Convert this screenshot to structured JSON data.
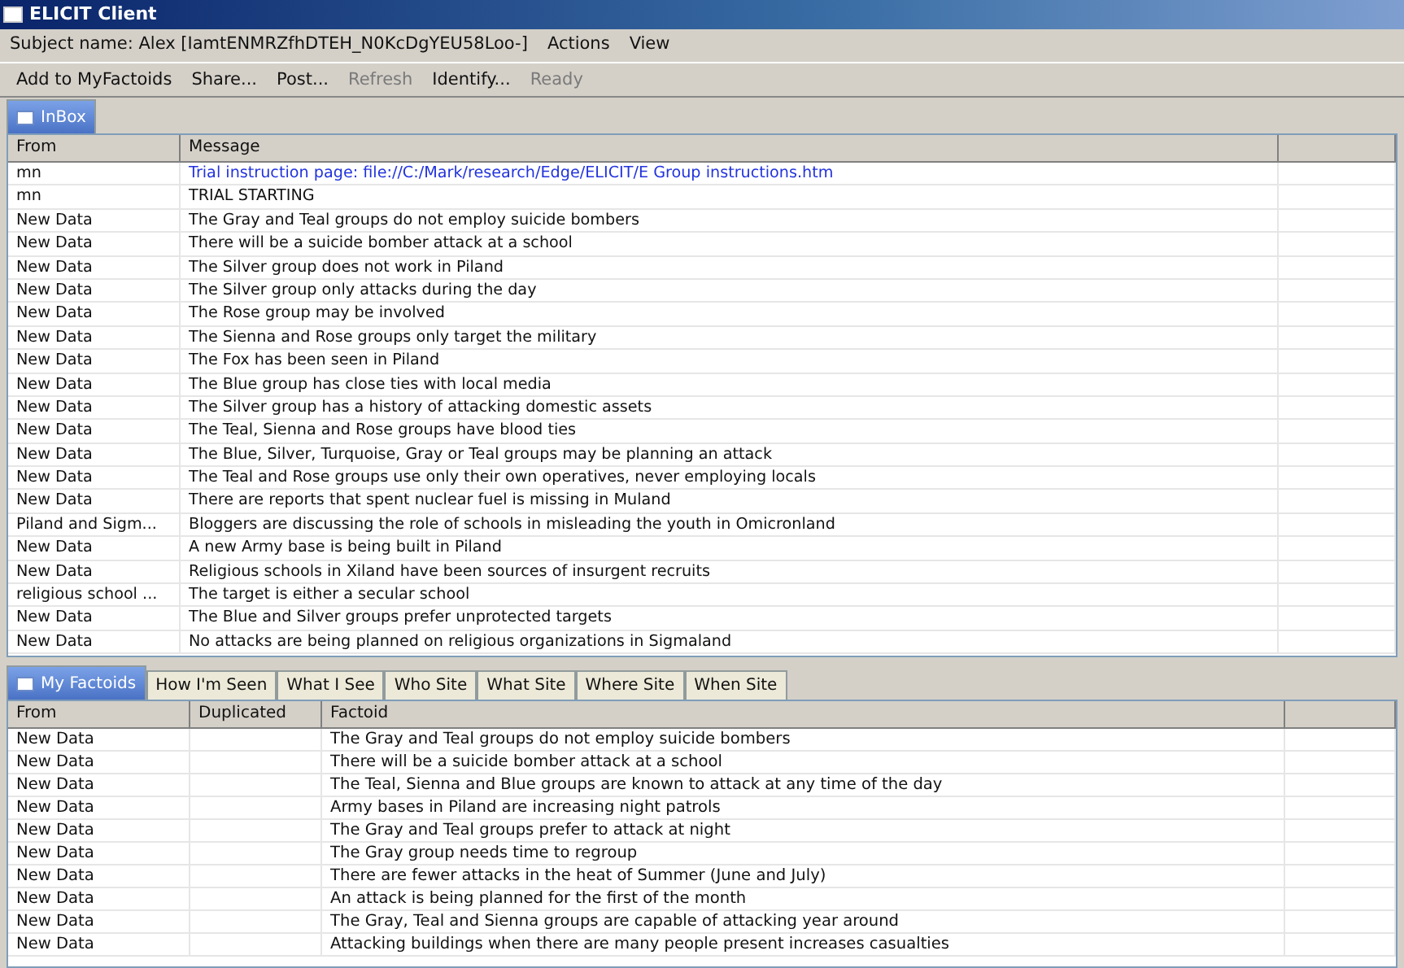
{
  "window": {
    "title": "ELICIT Client"
  },
  "menu_bar": [
    {
      "label": "Subject name: Alex  [IamtENMRZfhDTEH_N0KcDgYEU58Loo-]"
    },
    {
      "label": "Actions"
    },
    {
      "label": "View"
    }
  ],
  "toolbar": [
    {
      "label": "Add to MyFactoids",
      "disabled": false
    },
    {
      "label": "Share...",
      "disabled": false
    },
    {
      "label": "Post...",
      "disabled": false
    },
    {
      "label": "Refresh",
      "disabled": true
    },
    {
      "label": "Identify...",
      "disabled": false
    },
    {
      "label": "Ready",
      "disabled": true
    }
  ],
  "inbox": {
    "tabs": [
      {
        "label": "InBox",
        "selected": true
      }
    ],
    "columns": [
      "From",
      "Message"
    ],
    "rows": [
      {
        "from": "mn",
        "message": "Trial instruction page: file://C:/Mark/research/Edge/ELICIT/E Group instructions.htm",
        "kind": "link"
      },
      {
        "from": "mn",
        "message": "TRIAL STARTING",
        "kind": "text"
      },
      {
        "from": "New Data",
        "message": "The Gray and Teal groups do not employ suicide bombers",
        "kind": "text"
      },
      {
        "from": "New Data",
        "message": "There will be a suicide bomber attack at a school",
        "kind": "text"
      },
      {
        "from": "New Data",
        "message": "The Silver group does not work in Piland",
        "kind": "text"
      },
      {
        "from": "New Data",
        "message": "The Silver group only attacks during the day",
        "kind": "text"
      },
      {
        "from": "New Data",
        "message": "The Rose group may be involved",
        "kind": "text"
      },
      {
        "from": "New Data",
        "message": "The Sienna and Rose groups only target the military",
        "kind": "text"
      },
      {
        "from": "New Data",
        "message": "The Fox has been seen in Piland",
        "kind": "text"
      },
      {
        "from": "New Data",
        "message": "The Blue group has close ties with local media",
        "kind": "text"
      },
      {
        "from": "New Data",
        "message": "The Silver group has a history of attacking domestic assets",
        "kind": "text"
      },
      {
        "from": "New Data",
        "message": "The Teal, Sienna and Rose groups have blood ties",
        "kind": "text"
      },
      {
        "from": "New Data",
        "message": "The Blue, Silver, Turquoise, Gray or Teal groups may be planning an attack",
        "kind": "text"
      },
      {
        "from": "New Data",
        "message": "The Teal and Rose groups use only their own operatives, never employing locals",
        "kind": "text"
      },
      {
        "from": "New Data",
        "message": "There are reports that spent nuclear fuel is missing in Muland",
        "kind": "text"
      },
      {
        "from": "Piland and Sigm...",
        "message": "Bloggers are discussing the role of schools in misleading the youth in Omicronland",
        "kind": "text"
      },
      {
        "from": "New Data",
        "message": "A new Army base is being built in Piland",
        "kind": "text"
      },
      {
        "from": "New Data",
        "message": "Religious schools in Xiland have been sources of insurgent recruits",
        "kind": "text"
      },
      {
        "from": "religious school ...",
        "message": "The target is either a secular school",
        "kind": "text"
      },
      {
        "from": "New Data",
        "message": "The Blue and Silver groups prefer unprotected targets",
        "kind": "text"
      },
      {
        "from": "New Data",
        "message": "No attacks are being planned on religious organizations in Sigmaland",
        "kind": "text"
      }
    ]
  },
  "factoids": {
    "tabs": [
      {
        "label": "My Factoids",
        "selected": true
      },
      {
        "label": "How I'm Seen",
        "selected": false
      },
      {
        "label": "What I See",
        "selected": false
      },
      {
        "label": "Who Site",
        "selected": false
      },
      {
        "label": "What Site",
        "selected": false
      },
      {
        "label": "Where Site",
        "selected": false
      },
      {
        "label": "When Site",
        "selected": false
      }
    ],
    "columns": [
      "From",
      "Duplicated",
      "Factoid"
    ],
    "rows": [
      {
        "from": "New Data",
        "factoid": "The Gray and Teal groups do not employ suicide bombers"
      },
      {
        "from": "New Data",
        "factoid": "There will be a suicide bomber attack at a school"
      },
      {
        "from": "New Data",
        "factoid": "The Teal, Sienna and Blue groups are known to attack at any time of the day"
      },
      {
        "from": "New Data",
        "factoid": "Army bases in Piland are increasing night patrols"
      },
      {
        "from": "New Data",
        "factoid": "The Gray and Teal groups prefer to attack at night"
      },
      {
        "from": "New Data",
        "factoid": "The Gray group needs time to regroup"
      },
      {
        "from": "New Data",
        "factoid": "There are fewer attacks in the heat of Summer (June and July)"
      },
      {
        "from": "New Data",
        "factoid": "An attack is being planned for the first of the month"
      },
      {
        "from": "New Data",
        "factoid": "The Gray, Teal and Sienna groups are capable of attacking year around"
      },
      {
        "from": "New Data",
        "factoid": "Attacking buildings when there are many people present increases casualties"
      }
    ]
  }
}
